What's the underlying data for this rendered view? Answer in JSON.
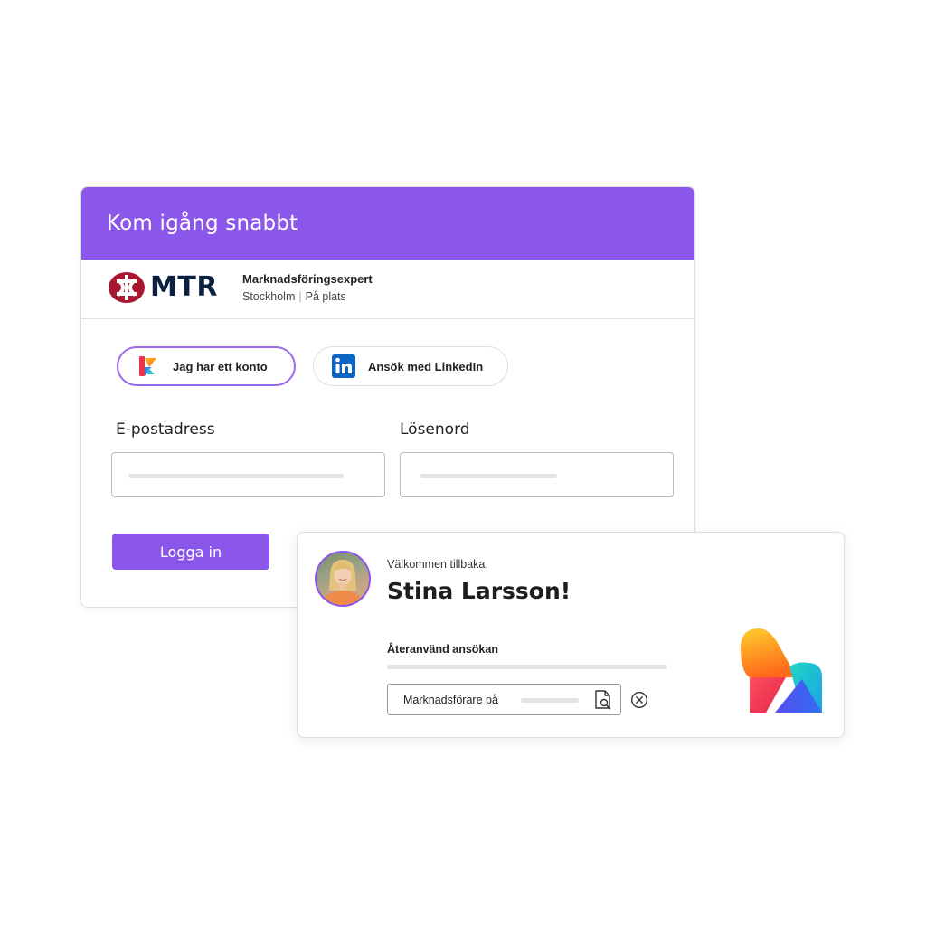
{
  "login_card": {
    "header_title": "Kom igång snabbt",
    "job": {
      "company_logo_text": "MTR",
      "title": "Marknadsföringsexpert",
      "location": "Stockholm",
      "work_mode": "På plats"
    },
    "auth_options": {
      "account_label": "Jag har ett konto",
      "linkedin_label": "Ansök med LinkedIn"
    },
    "fields": {
      "email_label": "E-postadress",
      "password_label": "Lösenord"
    },
    "login_button": "Logga in"
  },
  "welcome_card": {
    "greeting": "Välkommen tillbaka,",
    "user_name": "Stina Larsson!",
    "reuse_title": "Återanvänd ansökan",
    "document_name": "Marknadsförare på"
  },
  "colors": {
    "accent": "#8b57ea",
    "mtr_red": "#a8172f",
    "mtr_navy": "#0c2140",
    "linkedin_blue": "#0a66c2"
  },
  "icons": [
    "mtr-logo",
    "brand-k-icon",
    "linkedin-icon",
    "document-search-icon",
    "close-circle-icon",
    "brand-logo"
  ]
}
